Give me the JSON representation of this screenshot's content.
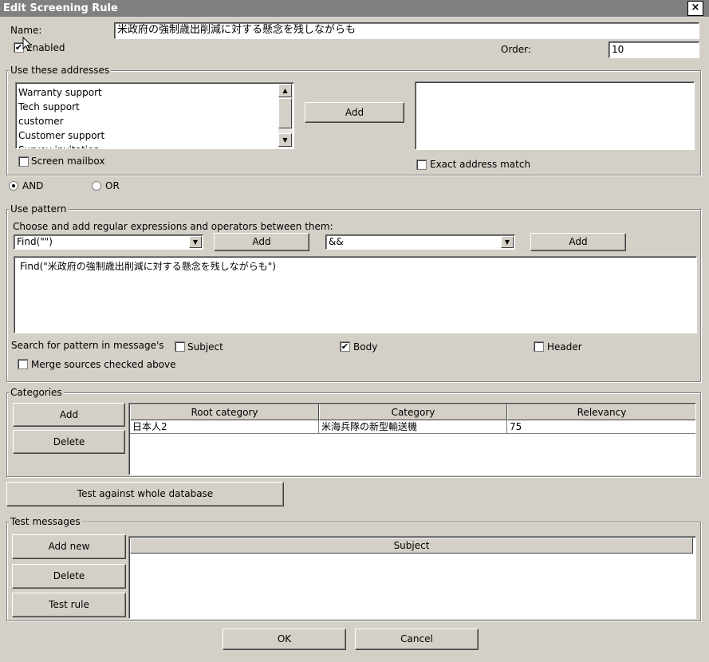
{
  "window": {
    "title": "Edit Screening Rule",
    "close_glyph": "×"
  },
  "name": {
    "label": "Name:",
    "value": "米政府の強制歳出削減に対する懸念を残しながらも"
  },
  "enabled": {
    "label": "Enabled",
    "checked": true
  },
  "order": {
    "label": "Order:",
    "value": "10"
  },
  "addresses": {
    "group_title": "Use these addresses",
    "items": [
      "Warranty support",
      "Tech support",
      "customer",
      "Customer support",
      "Survey invitation"
    ],
    "add_label": "Add",
    "screen_mailbox_label": "Screen mailbox",
    "exact_match_label": "Exact address match"
  },
  "logic": {
    "and_label": "AND",
    "or_label": "OR",
    "selected": "AND"
  },
  "pattern": {
    "group_title": "Use pattern",
    "instruction": "Choose and add regular expressions and operators between them:",
    "expression_combo": "Find(\"\")",
    "add_expression_label": "Add",
    "operator_combo": "&&",
    "add_operator_label": "Add",
    "text": "Find(\"米政府の強制歳出削減に対する懸念を残しながらも\")",
    "search_label": "Search for pattern in message's",
    "subject_label": "Subject",
    "body_label": "Body",
    "header_label": "Header",
    "merge_label": "Merge sources checked above"
  },
  "categories": {
    "group_title": "Categories",
    "add_label": "Add",
    "delete_label": "Delete",
    "columns": [
      "Root category",
      "Category",
      "Relevancy"
    ],
    "rows": [
      [
        "日本人2",
        "米海兵隊の新型輸送機",
        "75"
      ]
    ]
  },
  "test_db_label": "Test against whole database",
  "test_messages": {
    "group_title": "Test messages",
    "add_new_label": "Add new",
    "delete_label": "Delete",
    "test_rule_label": "Test rule",
    "columns": [
      "Subject"
    ]
  },
  "footer": {
    "ok_label": "OK",
    "cancel_label": "Cancel"
  },
  "icons": {
    "check": "✔",
    "scroll_up": "▲",
    "scroll_down": "▼",
    "combo_arrow": "▼",
    "cursor": "arrow-cursor-icon"
  }
}
